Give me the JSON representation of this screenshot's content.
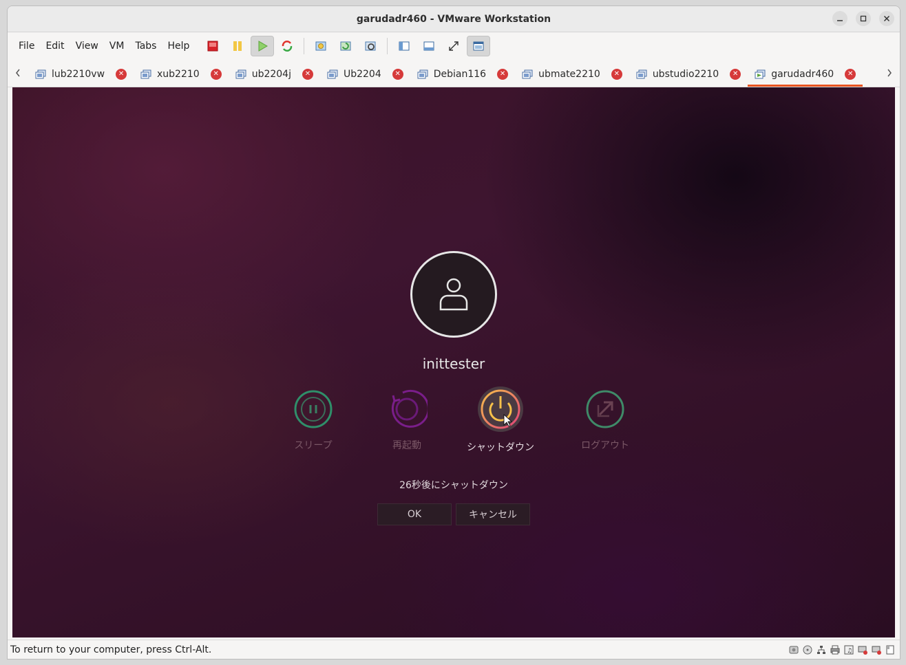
{
  "window": {
    "title": "garudadr460 - VMware Workstation",
    "controls": [
      "minimize",
      "maximize",
      "close"
    ]
  },
  "menubar": {
    "items": [
      "File",
      "Edit",
      "View",
      "VM",
      "Tabs",
      "Help"
    ]
  },
  "toolbar": {
    "icons": [
      "power-off-icon",
      "suspend-icon",
      "power-on-icon",
      "reset-icon",
      "snapshot-icon",
      "revert-snapshot-icon",
      "snapshot-manager-icon",
      "library-icon",
      "thumbnail-bar-icon",
      "fullscreen-icon",
      "unity-icon"
    ]
  },
  "tabs": {
    "items": [
      {
        "label": "lub2210vw",
        "selected": false
      },
      {
        "label": "xub2210",
        "selected": false
      },
      {
        "label": "ub2204j",
        "selected": false
      },
      {
        "label": "Ub2204",
        "selected": false
      },
      {
        "label": "Debian116",
        "selected": false
      },
      {
        "label": "ubmate2210",
        "selected": false
      },
      {
        "label": "ubstudio2210",
        "selected": false
      },
      {
        "label": "garudadr460",
        "selected": true
      }
    ]
  },
  "guest": {
    "username": "inittester",
    "actions": [
      {
        "label": "スリープ",
        "icon": "sleep-icon"
      },
      {
        "label": "再起動",
        "icon": "restart-icon"
      },
      {
        "label": "シャットダウン",
        "icon": "shutdown-icon",
        "selected": true
      },
      {
        "label": "ログアウト",
        "icon": "logout-icon"
      }
    ],
    "countdown": "26秒後にシャットダウン",
    "ok_label": "OK",
    "cancel_label": "キャンセル"
  },
  "statusbar": {
    "text": "To return to your computer, press Ctrl-Alt."
  },
  "colors": {
    "tab_accent": "#e95420",
    "tab_close": "#d63a3a",
    "sleep_ring": "#2f8f6a",
    "restart_ring": "#7a1e8a",
    "logout_ring": "#3f8a68"
  }
}
